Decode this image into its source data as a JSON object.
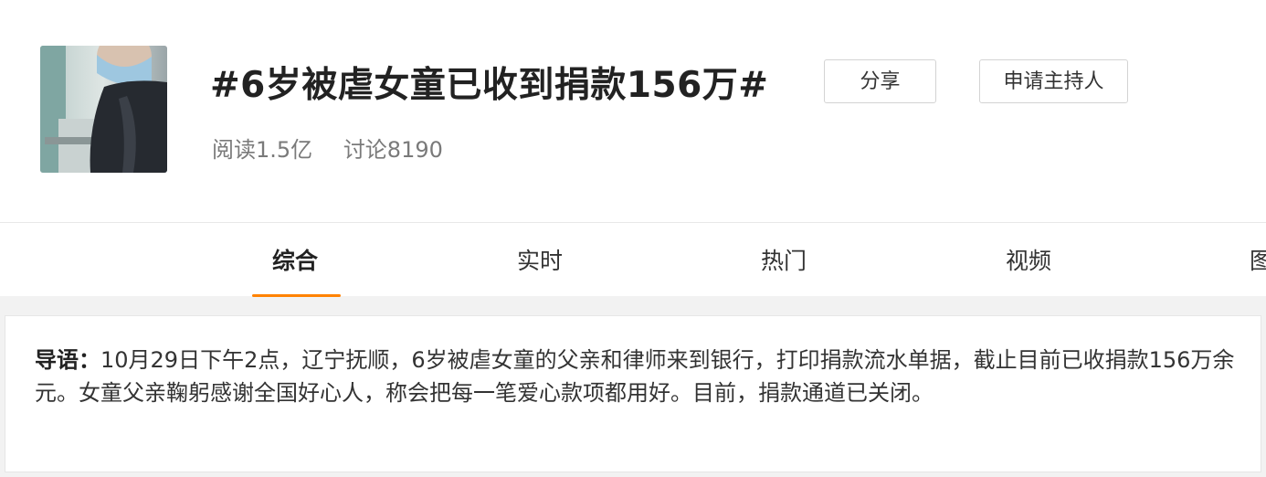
{
  "header": {
    "title": "#6岁被虐女童已收到捐款156万#",
    "read_stat": "阅读1.5亿",
    "discuss_stat": "讨论8190",
    "share_label": "分享",
    "host_label": "申请主持人"
  },
  "tabs": [
    {
      "label": "综合",
      "active": true
    },
    {
      "label": "实时",
      "active": false
    },
    {
      "label": "热门",
      "active": false
    },
    {
      "label": "视频",
      "active": false
    },
    {
      "label": "图",
      "active": false
    }
  ],
  "intro": {
    "label": "导语：",
    "text": "10月29日下午2点，辽宁抚顺，6岁被虐女童的父亲和律师来到银行，打印捐款流水单据，截止目前已收捐款156万余元。女童父亲鞠躬感谢全国好心人，称会把每一笔爱心款项都用好。目前，捐款通道已关闭。"
  },
  "colors": {
    "accent": "#ff8200",
    "page_bg": "#f2f2f2"
  }
}
